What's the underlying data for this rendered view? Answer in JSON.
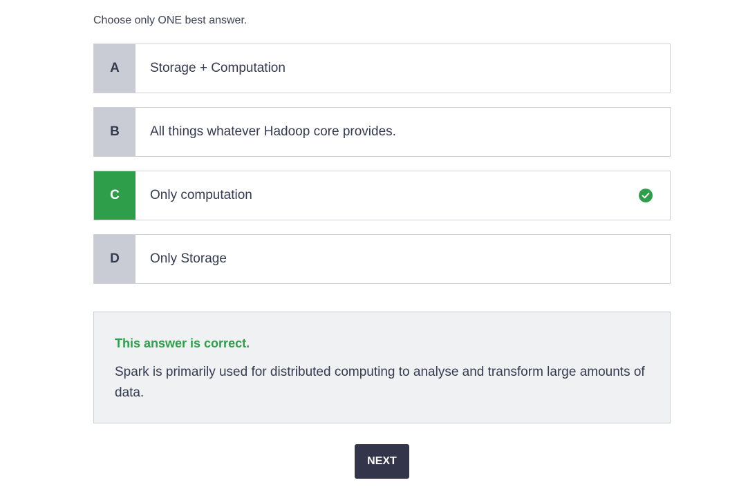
{
  "instruction": "Choose only ONE best answer.",
  "options": [
    {
      "letter": "A",
      "text": "Storage + Computation",
      "state": "default"
    },
    {
      "letter": "B",
      "text": "All things whatever Hadoop core provides.",
      "state": "default"
    },
    {
      "letter": "C",
      "text": "Only computation",
      "state": "correct",
      "icon": "check-circle-icon"
    },
    {
      "letter": "D",
      "text": "Only Storage",
      "state": "default"
    }
  ],
  "feedback": {
    "title": "This answer is correct.",
    "body": "Spark is primarily used for distributed computing to analyse and transform large amounts of data."
  },
  "next_label": "NEXT",
  "colors": {
    "correct_green": "#2f9e4a",
    "letter_bg": "#c9ccd5",
    "button_bg": "#33364a",
    "feedback_bg": "#f0f1f3"
  }
}
